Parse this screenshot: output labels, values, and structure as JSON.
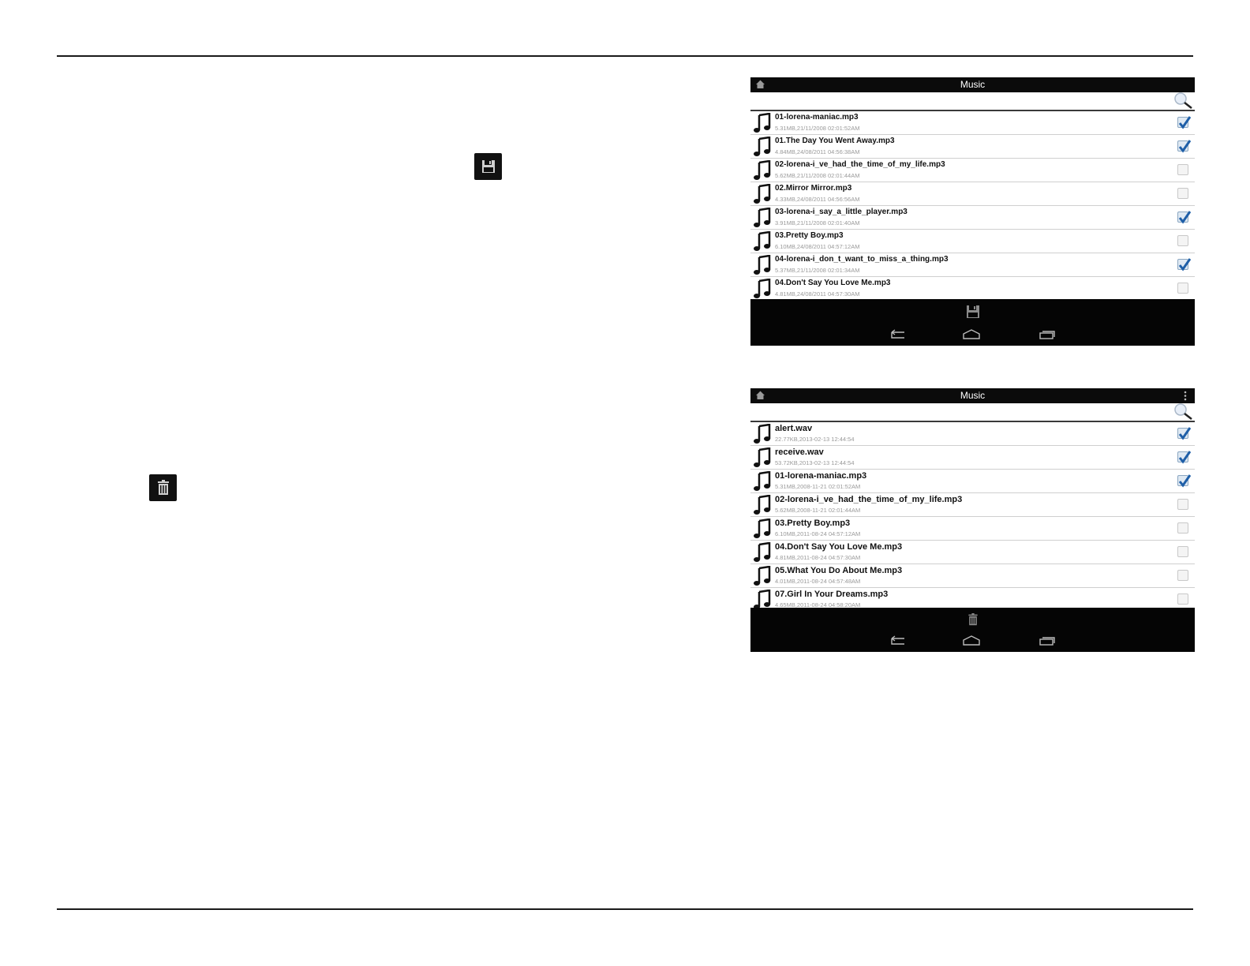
{
  "inline_icons": {
    "save": "save-icon",
    "delete": "trash-icon"
  },
  "screen1": {
    "title": "Music",
    "files": [
      {
        "name": "01-lorena-maniac.mp3",
        "meta": "5.31MB,21/11/2008 02:01:52AM",
        "checked": true
      },
      {
        "name": "01.The Day You Went Away.mp3",
        "meta": "4.84MB,24/08/2011 04:56:38AM",
        "checked": true
      },
      {
        "name": "02-lorena-i_ve_had_the_time_of_my_life.mp3",
        "meta": "5.62MB,21/11/2008 02:01:44AM",
        "checked": false
      },
      {
        "name": "02.Mirror Mirror.mp3",
        "meta": "4.33MB,24/08/2011 04:56:56AM",
        "checked": false
      },
      {
        "name": "03-lorena-i_say_a_little_player.mp3",
        "meta": "3.91MB,21/11/2008 02:01:40AM",
        "checked": true
      },
      {
        "name": "03.Pretty Boy.mp3",
        "meta": "6.10MB,24/08/2011 04:57:12AM",
        "checked": false
      },
      {
        "name": "04-lorena-i_don_t_want_to_miss_a_thing.mp3",
        "meta": "5.37MB,21/11/2008 02:01:34AM",
        "checked": true
      },
      {
        "name": "04.Don't Say You Love Me.mp3",
        "meta": "4.81MB,24/08/2011 04:57:30AM",
        "checked": false
      }
    ],
    "action_icon": "save-icon"
  },
  "screen2": {
    "title": "Music",
    "files": [
      {
        "name": "alert.wav",
        "meta": "22.77KB,2013-02-13 12:44:54",
        "checked": true
      },
      {
        "name": "receive.wav",
        "meta": "53.72KB,2013-02-13 12:44:54",
        "checked": true
      },
      {
        "name": "01-lorena-maniac.mp3",
        "meta": "5.31MB,2008-11-21 02:01:52AM",
        "checked": true
      },
      {
        "name": "02-lorena-i_ve_had_the_time_of_my_life.mp3",
        "meta": "5.62MB,2008-11-21 02:01:44AM",
        "checked": false
      },
      {
        "name": "03.Pretty Boy.mp3",
        "meta": "6.10MB,2011-08-24 04:57:12AM",
        "checked": false
      },
      {
        "name": "04.Don't Say You Love Me.mp3",
        "meta": "4.81MB,2011-08-24 04:57:30AM",
        "checked": false
      },
      {
        "name": "05.What You Do About Me.mp3",
        "meta": "4.01MB,2011-08-24 04:57:48AM",
        "checked": false
      },
      {
        "name": "07.Girl In Your Dreams.mp3",
        "meta": "4.65MB,2011-08-24 04:58:20AM",
        "checked": false
      }
    ],
    "action_icon": "trash-icon"
  },
  "colors": {
    "bar": "#0b0b0b",
    "check_on": "#1f5fa8"
  }
}
